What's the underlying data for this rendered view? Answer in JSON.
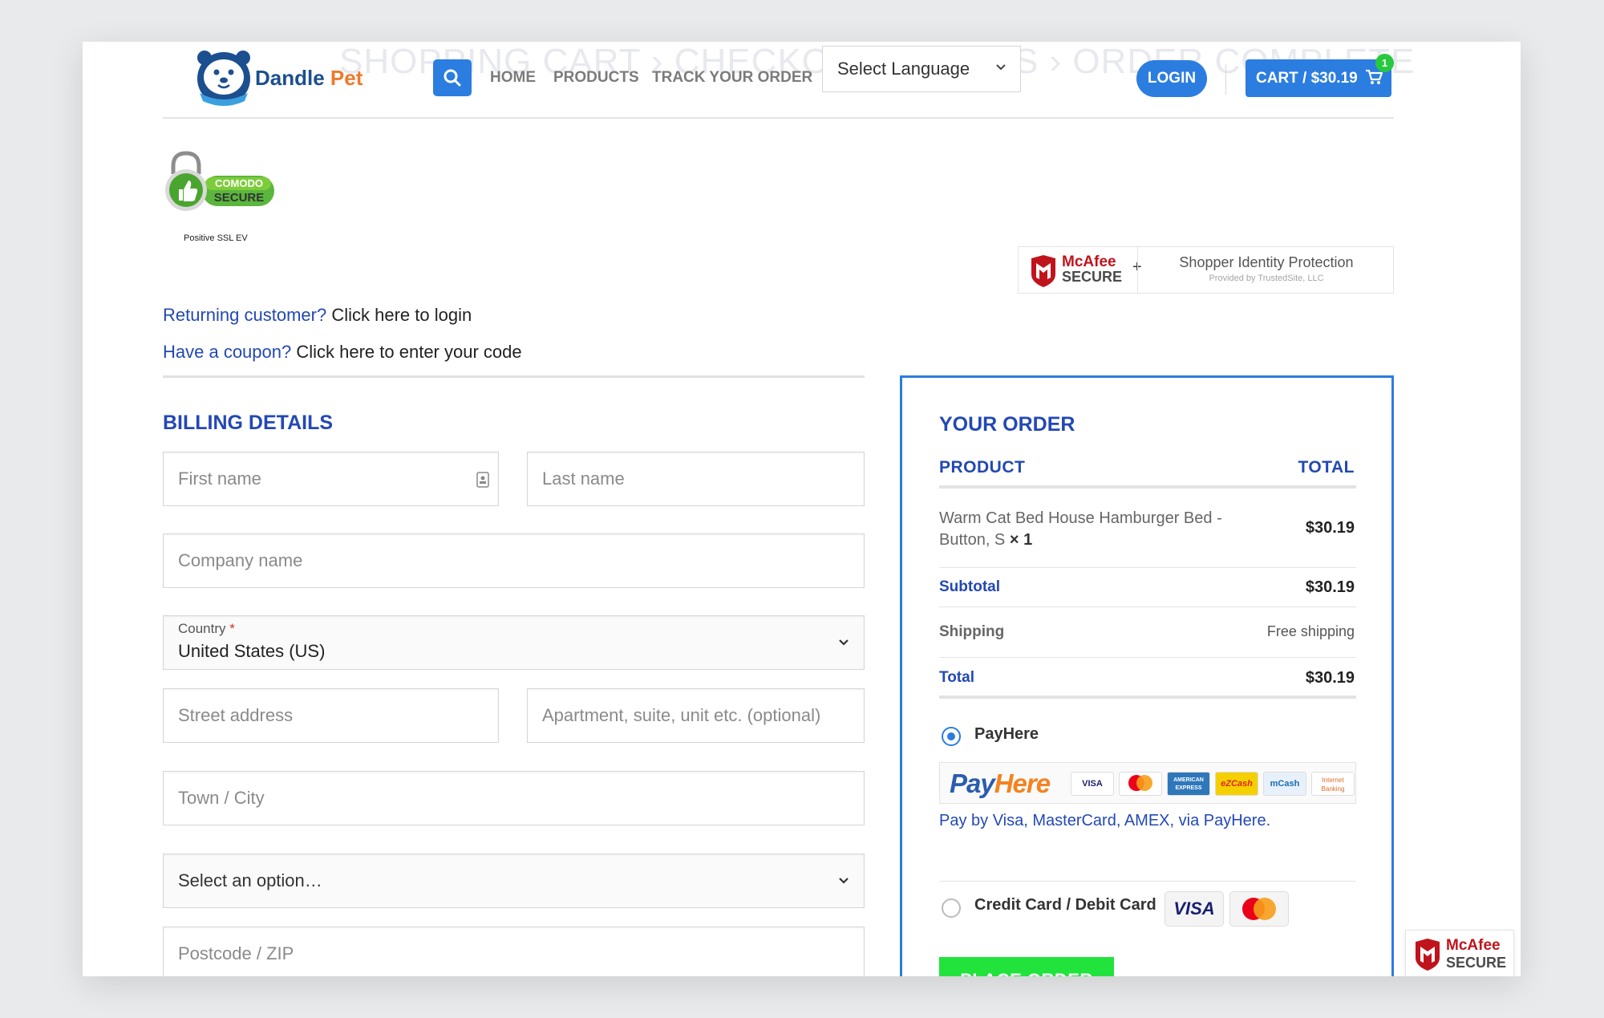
{
  "header": {
    "ghost_title": "SHOPPING CART  ›  CHECKOUT DETAILS  ›  ORDER COMPLETE",
    "logo_part1": "Dandle",
    "logo_part2": "Pet",
    "nav": [
      "HOME",
      "PRODUCTS",
      "TRACK YOUR ORDER"
    ],
    "language": "Select Language",
    "login_label": "LOGIN",
    "cart_label": "CART / $30.19",
    "cart_count": "1"
  },
  "badges": {
    "comodo_line1": "COMODO",
    "comodo_line2": "SECURE",
    "comodo_caption": "Positive SSL EV",
    "mcafee_name": "McAfee",
    "mcafee_secure": "SECURE",
    "shopper_title": "Shopper Identity Protection",
    "shopper_sub": "Provided by TrustedSite, LLC"
  },
  "notices": {
    "returning_q": "Returning customer?",
    "returning_link": "Click here to login",
    "coupon_q": "Have a coupon?",
    "coupon_link": "Click here to enter your code"
  },
  "billing": {
    "title": "BILLING DETAILS",
    "first_name": "First name",
    "last_name": "Last name",
    "company": "Company name",
    "country_label": "Country",
    "country_required": "*",
    "country_value": "United States (US)",
    "street": "Street address",
    "apartment": "Apartment, suite, unit etc. (optional)",
    "town": "Town / City",
    "state": "Select an option…",
    "postcode": "Postcode / ZIP"
  },
  "order": {
    "title": "YOUR ORDER",
    "col_product": "PRODUCT",
    "col_total": "TOTAL",
    "product_name": "Warm Cat Bed House Hamburger Bed - Button, S",
    "product_qty": "× 1",
    "product_price": "$30.19",
    "subtotal_label": "Subtotal",
    "subtotal_value": "$30.19",
    "shipping_label": "Shipping",
    "shipping_value": "Free shipping",
    "total_label": "Total",
    "total_value": "$30.19",
    "payment_methods": [
      {
        "label": "PayHere",
        "selected": true
      },
      {
        "label": "Credit Card / Debit Card",
        "selected": false
      }
    ],
    "payhere_logo_a": "Pay",
    "payhere_logo_b": "Here",
    "payhere_cards": [
      "VISA",
      "MasterCard",
      "AMERICAN EXPRESS",
      "eZCash",
      "mCash",
      "Internet Banking"
    ],
    "payhere_desc": "Pay by Visa, MasterCard, AMEX, via PayHere.",
    "visa_text": "VISA",
    "place_order": "PLACE ORDER"
  },
  "colors": {
    "brand_blue": "#2b7de0",
    "heading_blue": "#2348b5",
    "place_order_green": "#22e23c",
    "mcafee_red": "#c0141c"
  }
}
